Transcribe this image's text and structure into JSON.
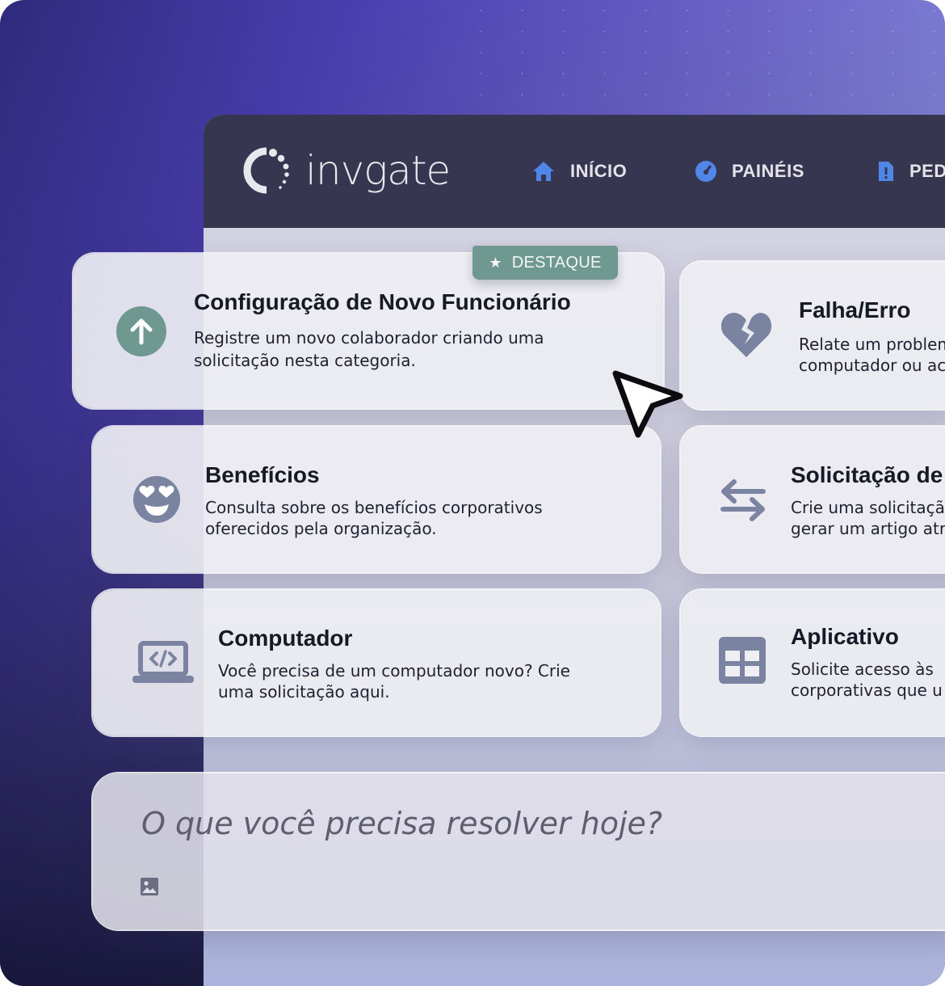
{
  "brand": {
    "name": "invgate"
  },
  "nav": [
    {
      "label": "INÍCIO",
      "icon": "home-icon"
    },
    {
      "label": "PAINÉIS",
      "icon": "gauge-icon"
    },
    {
      "label": "PED",
      "icon": "document-alert-icon"
    }
  ],
  "featured_badge": {
    "label": "DESTAQUE",
    "icon": "star-icon"
  },
  "cards": [
    {
      "title": "Configuração de Novo Funcionário",
      "desc_line1": "Registre um novo colaborador criando uma",
      "desc_line2": "solicitação nesta categoria.",
      "icon": "arrow-up-circle-icon"
    },
    {
      "title": "Falha/Erro",
      "desc_line1": "Relate um problem",
      "desc_line2": "computador ou ac",
      "icon": "broken-heart-icon"
    },
    {
      "title": "Benefícios",
      "desc_line1": "Consulta sobre os benefícios corporativos",
      "desc_line2": "oferecidos pela organização.",
      "icon": "heart-eyes-face-icon"
    },
    {
      "title": "Solicitação de",
      "desc_line1": "Crie uma solicitaçã",
      "desc_line2": "gerar um artigo atr",
      "icon": "swap-arrows-icon"
    },
    {
      "title": "Computador",
      "desc_line1": "Você precisa de um computador novo? Crie",
      "desc_line2": "uma solicitação aqui.",
      "icon": "laptop-code-icon"
    },
    {
      "title": "Aplicativo",
      "desc_line1": "Solicite acesso às",
      "desc_line2": "corporativas que u",
      "icon": "grid-icon"
    }
  ],
  "search": {
    "placeholder": "O que você precisa resolver hoje?",
    "attach_icon": "image-icon"
  },
  "colors": {
    "header_bg": "#373650",
    "accent_blue": "#4f86e8",
    "badge_green": "#6e9890",
    "icon_slate": "#7a84a0"
  }
}
